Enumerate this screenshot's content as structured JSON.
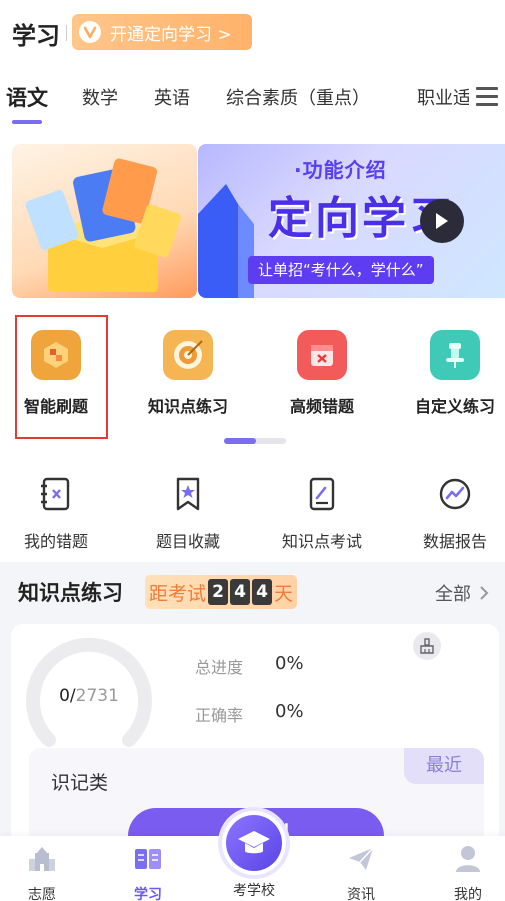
{
  "header": {
    "title": "学习",
    "promo_label": "开通定向学习 >"
  },
  "tabs": [
    {
      "label": "语文",
      "active": true
    },
    {
      "label": "数学"
    },
    {
      "label": "英语"
    },
    {
      "label": "综合素质（重点）"
    },
    {
      "label": "职业适"
    }
  ],
  "banner": {
    "subtitle": "·功能介绍",
    "title": "定向学习",
    "slogan": "让单招“考什么，学什么”"
  },
  "functions": [
    {
      "label": "智能刷题",
      "icon": "smart-quiz-icon",
      "color": "#f0a43c"
    },
    {
      "label": "知识点练习",
      "icon": "target-icon",
      "color": "#f4b552"
    },
    {
      "label": "高频错题",
      "icon": "error-calendar-icon",
      "color": "#f35a5a"
    },
    {
      "label": "自定义练习",
      "icon": "pin-icon",
      "color": "#3fc9b7"
    }
  ],
  "tools": [
    {
      "label": "我的错题",
      "icon": "error-notebook-icon"
    },
    {
      "label": "题目收藏",
      "icon": "bookmark-star-icon"
    },
    {
      "label": "知识点考试",
      "icon": "exam-paper-icon"
    },
    {
      "label": "数据报告",
      "icon": "trend-chart-icon"
    }
  ],
  "practice": {
    "title": "知识点练习",
    "countdown_prefix": "距考试",
    "countdown_digits": [
      "2",
      "4",
      "4"
    ],
    "countdown_suffix": "天",
    "see_all": "全部",
    "done": "0",
    "total": "2731",
    "progress_label": "总进度",
    "progress_value": "0%",
    "accuracy_label": "正确率",
    "accuracy_value": "0%",
    "category": "识记类",
    "recent_tag": "最近",
    "start_label": "开始刷"
  },
  "bottom_nav": [
    {
      "label": "志愿",
      "icon": "building-icon"
    },
    {
      "label": "学习",
      "icon": "book-icon",
      "active": true
    },
    {
      "label": "考学校",
      "icon": "graduation-cap-icon"
    },
    {
      "label": "资讯",
      "icon": "paper-plane-icon"
    },
    {
      "label": "我的",
      "icon": "user-icon"
    }
  ],
  "colors": {
    "accent": "#7a6df0",
    "promo": "#ffb26a",
    "highlight": "#e53935"
  }
}
